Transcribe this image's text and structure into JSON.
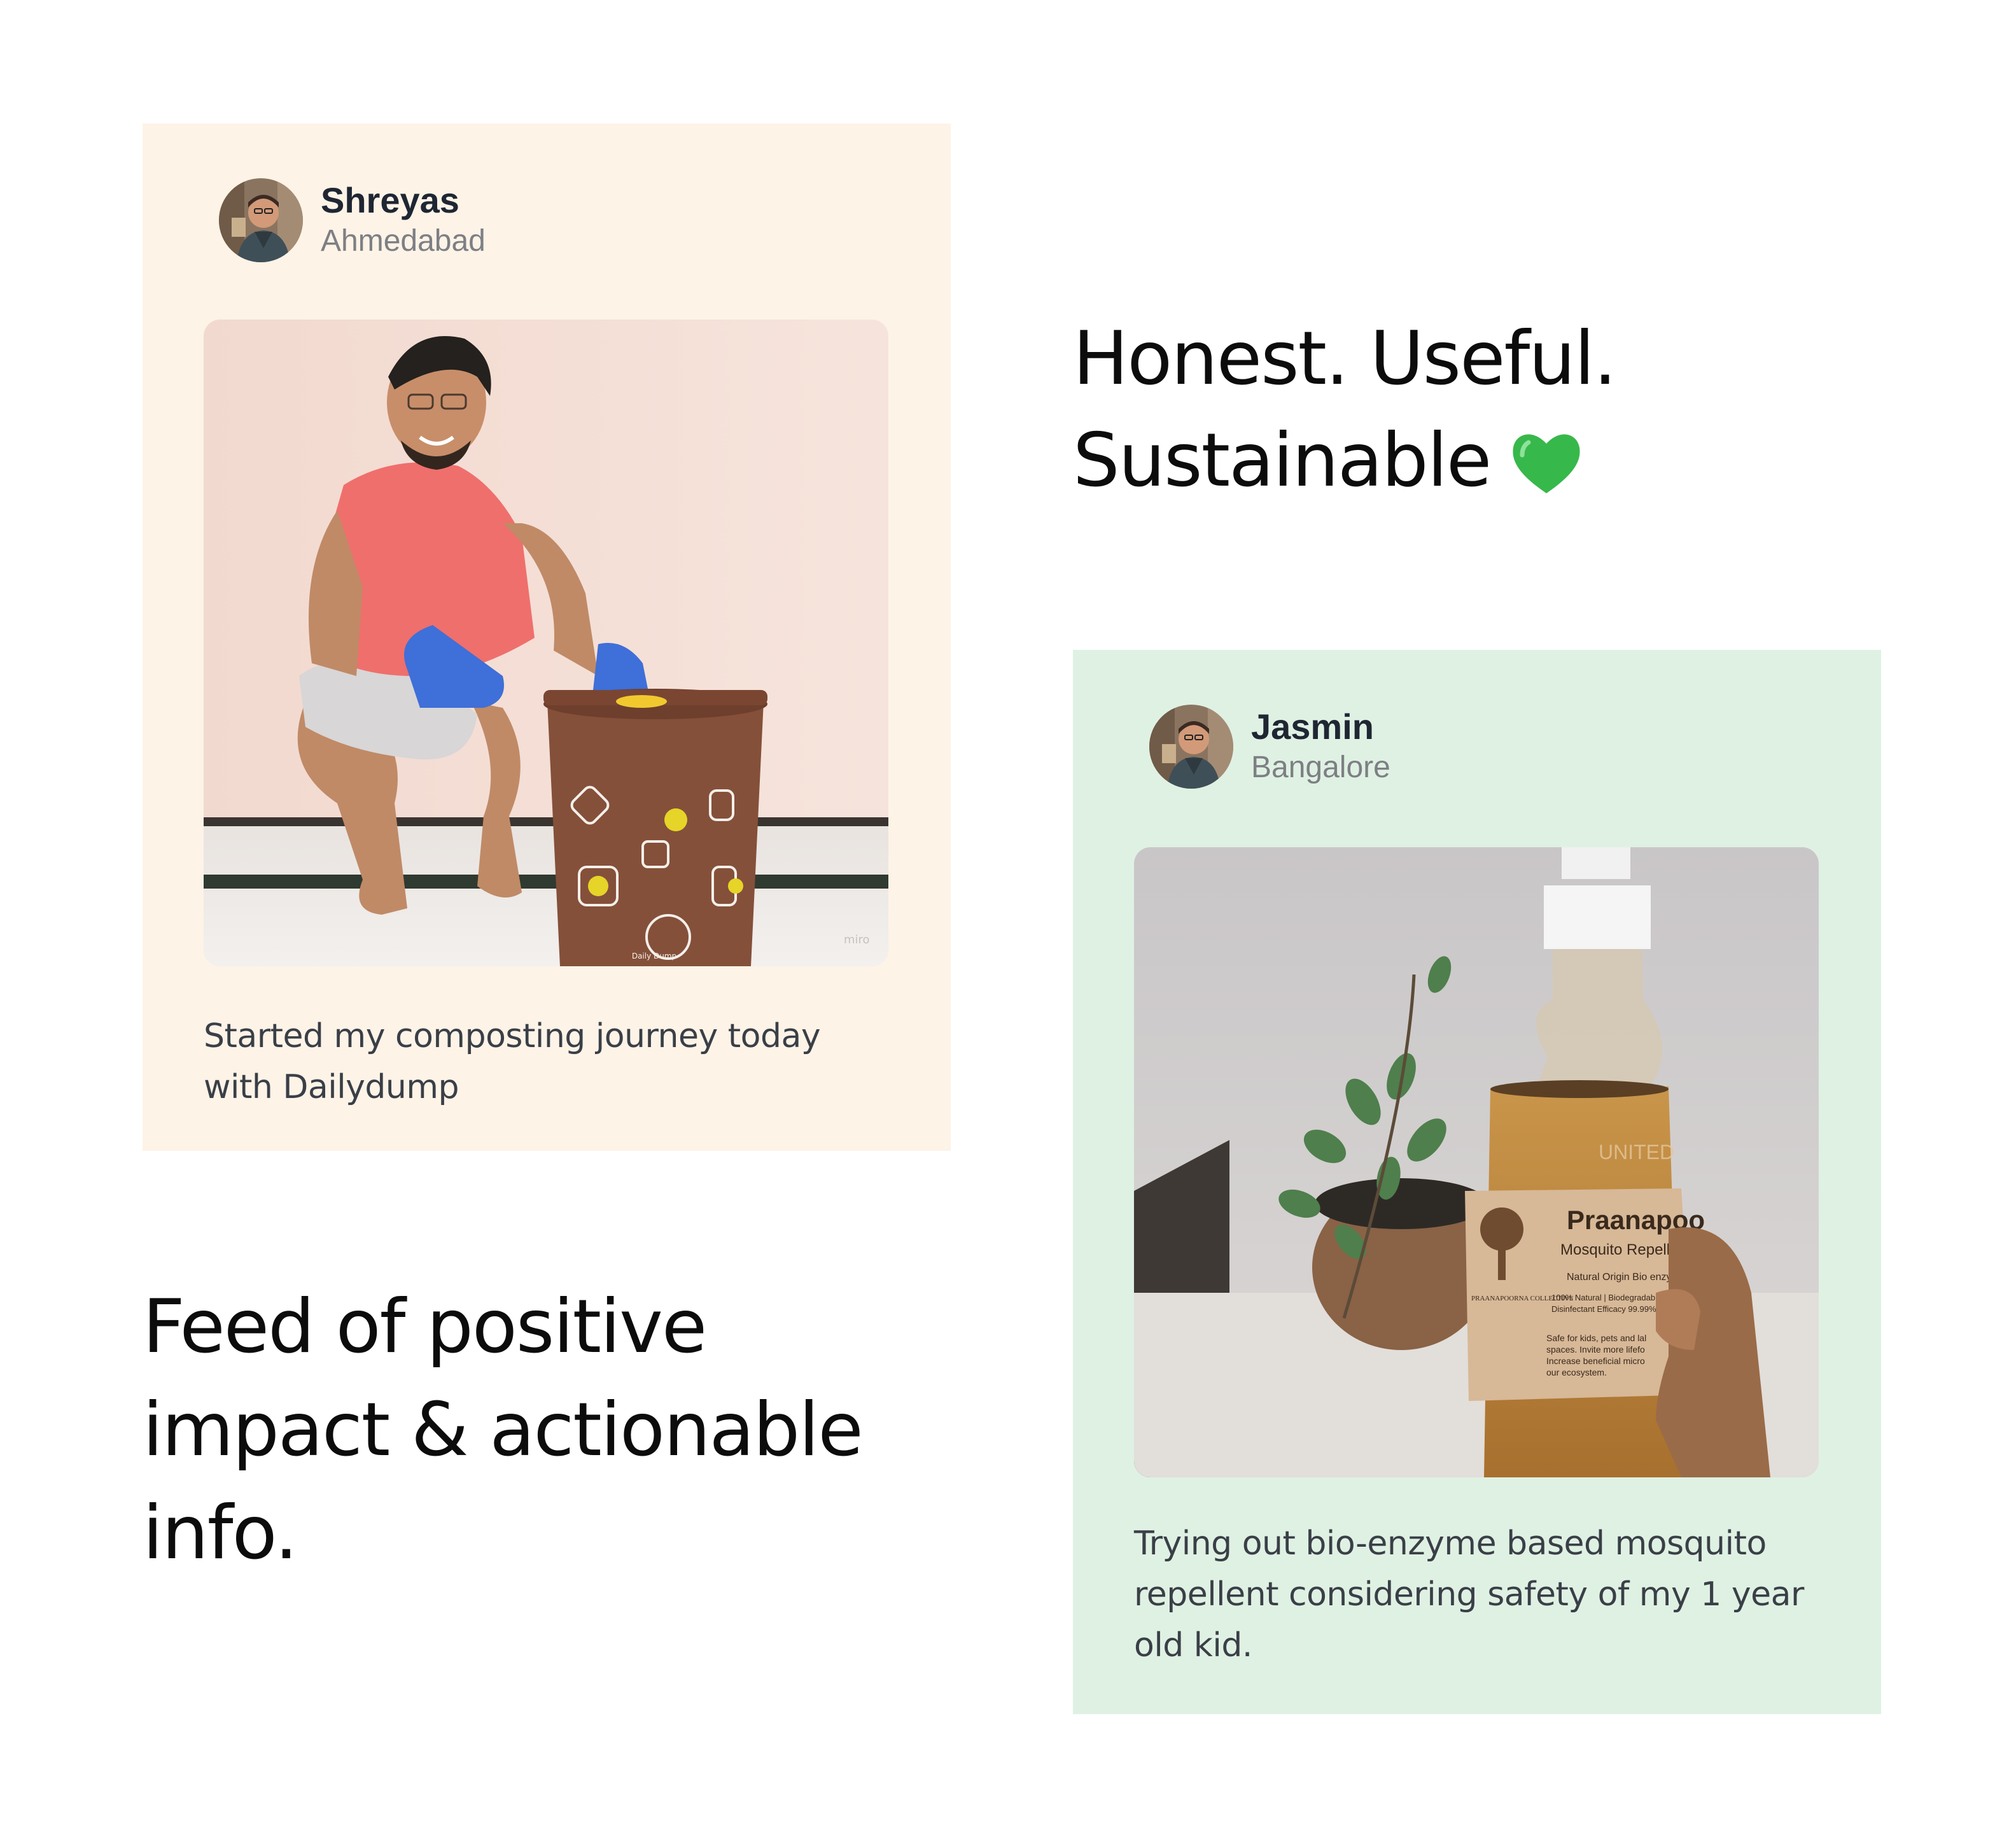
{
  "posts": [
    {
      "author": "Shreyas",
      "location": "Ahmedabad",
      "caption_lines": [
        "Started my composting journey today",
        "with Dailydump"
      ],
      "photo_subject": "man-with-compost-bin",
      "bin_label": "Daily Dump",
      "watermark": "miro",
      "background": "#fdf3e7"
    },
    {
      "author": "Jasmin",
      "location": "Bangalore",
      "caption_lines": [
        "Trying out bio-enzyme based mosquito",
        "repellent considering safety of my 1 year",
        "old kid."
      ],
      "photo_subject": "mosquito-repellent-bottle",
      "bottle_label": {
        "brand": "Praanapoo",
        "product": "Mosquito Repellen",
        "tagline": "Natural Origin Bio enzyme",
        "collective": "PRAANAPOORNA COLLECTIVE",
        "claims": [
          "100% Natural | Biodegradab",
          "Disinfectant Efficacy 99.99%"
        ],
        "safety": [
          "Safe for kids, pets and lal",
          "spaces. Invite more lifefo",
          "Increase beneficial micro",
          "our ecosystem."
        ],
        "embossed": "UNITED"
      },
      "background": "#dff1e3"
    }
  ],
  "headlines": {
    "primary": {
      "line1": "Honest. Useful.",
      "line2": "Sustainable",
      "emoji": "green-heart-icon",
      "emoji_color": "#37b84b"
    },
    "secondary": {
      "line1": "Feed of positive",
      "line2": "impact & actionable",
      "line3": "info."
    }
  }
}
